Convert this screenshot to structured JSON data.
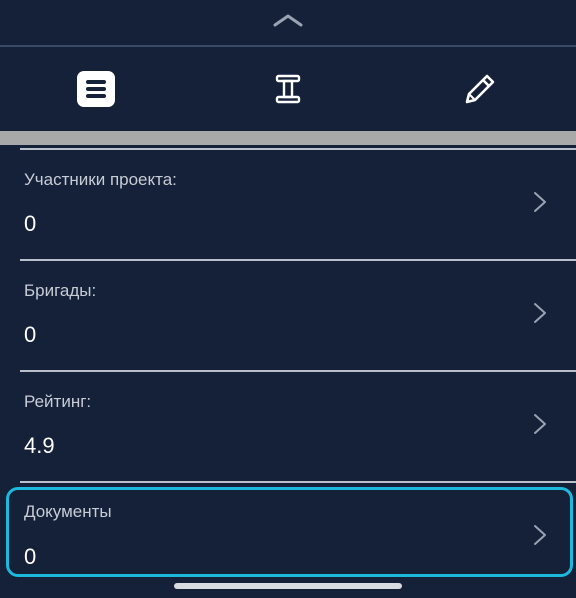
{
  "sheet": {
    "collapse_icon": "chevron-up-icon"
  },
  "toolbar": {
    "items": [
      {
        "icon": "list-icon"
      },
      {
        "icon": "text-cursor-icon"
      },
      {
        "icon": "pencil-icon"
      }
    ]
  },
  "rows": [
    {
      "label": "Участники проекта:",
      "value": "0"
    },
    {
      "label": "Бригады:",
      "value": "0"
    },
    {
      "label": "Рейтинг:",
      "value": "4.9"
    },
    {
      "label": "Документы",
      "value": "0"
    }
  ],
  "colors": {
    "background": "#142138",
    "highlight": "#1fb8dd",
    "band": "#a9a9aa"
  }
}
